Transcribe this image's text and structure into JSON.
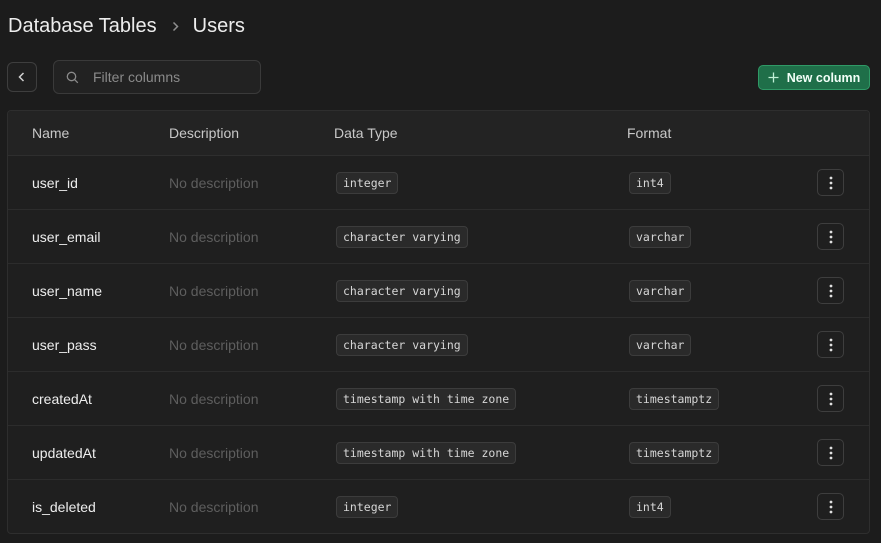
{
  "breadcrumb": {
    "parent": "Database Tables",
    "current": "Users"
  },
  "search": {
    "placeholder": "Filter columns",
    "value": ""
  },
  "actions": {
    "new_column_label": "New column"
  },
  "table": {
    "headers": {
      "name": "Name",
      "description": "Description",
      "data_type": "Data Type",
      "format": "Format"
    },
    "rows": [
      {
        "name": "user_id",
        "description": "No description",
        "data_type": "integer",
        "format": "int4"
      },
      {
        "name": "user_email",
        "description": "No description",
        "data_type": "character varying",
        "format": "varchar"
      },
      {
        "name": "user_name",
        "description": "No description",
        "data_type": "character varying",
        "format": "varchar"
      },
      {
        "name": "user_pass",
        "description": "No description",
        "data_type": "character varying",
        "format": "varchar"
      },
      {
        "name": "createdAt",
        "description": "No description",
        "data_type": "timestamp with time zone",
        "format": "timestamptz"
      },
      {
        "name": "updatedAt",
        "description": "No description",
        "data_type": "timestamp with time zone",
        "format": "timestamptz"
      },
      {
        "name": "is_deleted",
        "description": "No description",
        "data_type": "integer",
        "format": "int4"
      }
    ]
  },
  "icons": {
    "separator": "chevron-right-icon",
    "back": "chevron-left-icon",
    "search": "search-icon",
    "add": "plus-icon",
    "row_menu": "more-vertical-icon"
  },
  "colors": {
    "background": "#1c1c1c",
    "accent": "#1f6f49",
    "accent_border": "#2f9a66"
  }
}
